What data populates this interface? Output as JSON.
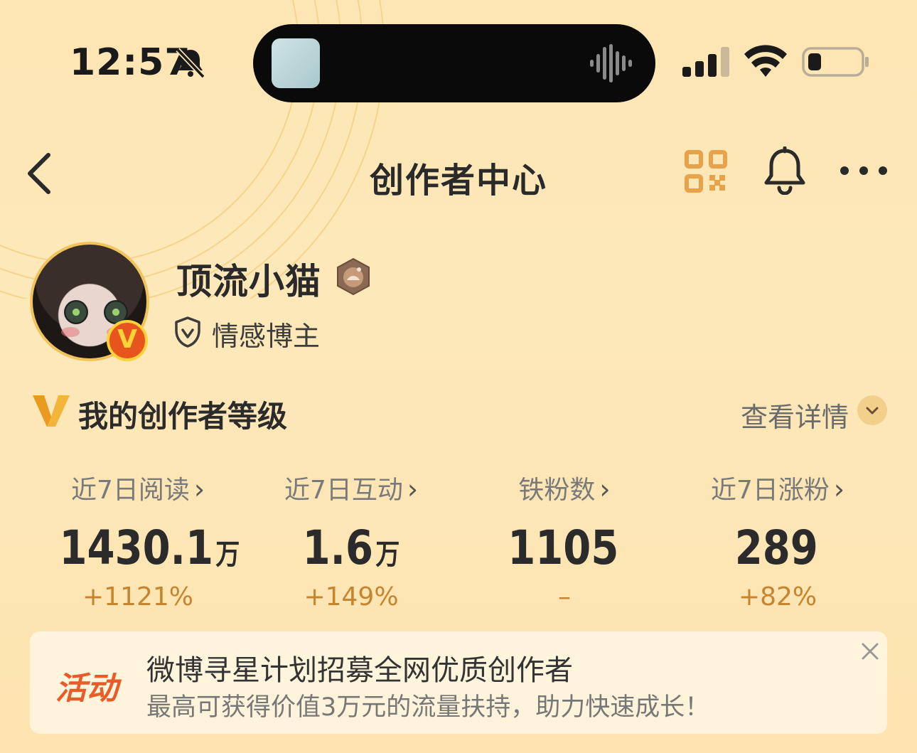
{
  "status_bar": {
    "time": "12:57",
    "icons": [
      "bell-off-icon",
      "signal-icon",
      "wifi-icon",
      "battery-icon"
    ]
  },
  "nav": {
    "title": "创作者中心",
    "icons": [
      "back-icon",
      "qr-code-icon",
      "notification-bell-icon",
      "more-icon"
    ]
  },
  "profile": {
    "username": "顶流小猫",
    "role": "情感博主",
    "verified_badge": "V"
  },
  "level": {
    "title": "我的创作者等级",
    "details_link": "查看详情"
  },
  "stats": [
    {
      "label": "近7日阅读",
      "value": "1430.1",
      "unit": "万",
      "change": "+1121%"
    },
    {
      "label": "近7日互动",
      "value": "1.6",
      "unit": "万",
      "change": "+149%"
    },
    {
      "label": "铁粉数",
      "value": "1105",
      "unit": "",
      "change": "–"
    },
    {
      "label": "近7日涨粉",
      "value": "289",
      "unit": "",
      "change": "+82%"
    }
  ],
  "banner": {
    "tag": "活动",
    "title": "微博寻星计划招募全网优质创作者",
    "subtitle": "最高可获得价值3万元的流量扶持，助力快速成长！"
  },
  "colors": {
    "background": "#fde6b3",
    "accent_orange": "#c7842f",
    "tag_red": "#ea5b2a",
    "qr_icon": "#e7a24a"
  }
}
